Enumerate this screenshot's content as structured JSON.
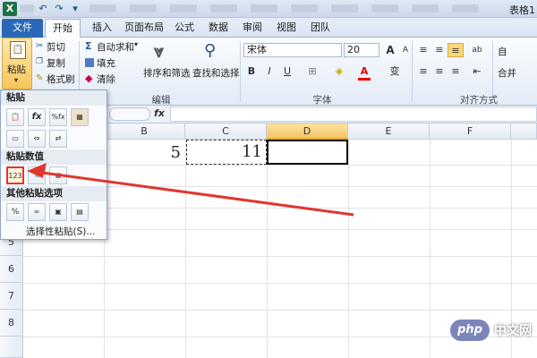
{
  "titlebar": {
    "icon": "X",
    "doc_title": "表格1"
  },
  "tabs": [
    "文件",
    "开始",
    "插入",
    "页面布局",
    "公式",
    "数据",
    "审阅",
    "视图",
    "团队"
  ],
  "clipboard": {
    "paste_label": "粘贴",
    "cut": "剪切",
    "copy": "复制",
    "format_painter": "格式刷"
  },
  "editing": {
    "autosum": "自动求和",
    "fill": "填充",
    "clear": "清除",
    "sort_filter": "排序和筛选",
    "find_select": "查找和选择",
    "group_label": "编辑"
  },
  "font": {
    "name": "宋体",
    "size": "20",
    "bold": "B",
    "italic": "I",
    "underline": "U",
    "group_label": "字体",
    "font_color_sym": "A",
    "wen": "变"
  },
  "alignment": {
    "group_label": "对齐方式",
    "wrap_fragment": "自",
    "merge_fragment": "合并"
  },
  "formula_bar": {
    "fx": "fx"
  },
  "grid": {
    "columns": [
      "B",
      "C",
      "D",
      "E",
      "F"
    ],
    "rows": [
      "5",
      "6",
      "7",
      "8"
    ],
    "cell_B": "5",
    "cell_C": "11"
  },
  "paste_menu": {
    "section_paste": "粘贴",
    "section_values": "粘贴数值",
    "section_other": "其他粘贴选项",
    "special": "选择性粘贴(S)...",
    "value_icon": "123"
  },
  "watermark": {
    "logo": "php",
    "site": "中文网"
  },
  "colors": {
    "accent_file": "#2a68b7",
    "arrow": "#e0362f",
    "excel_green": "#1e7145"
  }
}
